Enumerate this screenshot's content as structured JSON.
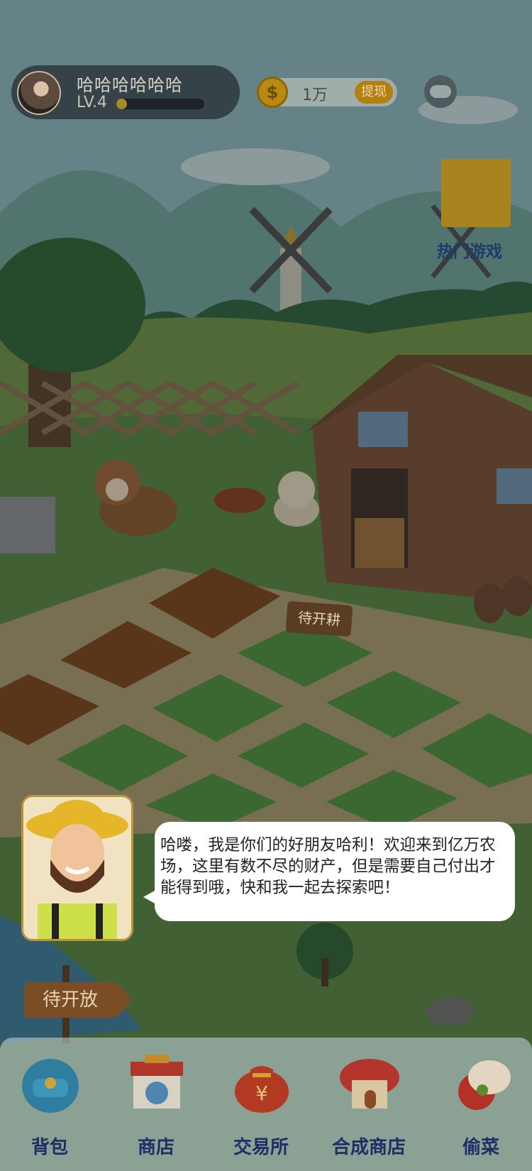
{
  "profile": {
    "name": "哈哈哈哈哈哈",
    "level": "LV.4",
    "level_progress": 0.12
  },
  "currency": {
    "icon": "coin-icon",
    "coin_symbol": "$",
    "amount": "1万",
    "withdraw_label": "提现"
  },
  "weather": {
    "icon": "cloudy-icon"
  },
  "hot_games": {
    "label": "热门游戏"
  },
  "field_sign": {
    "label": "待开耕"
  },
  "road_sign": {
    "label": "待开放"
  },
  "dialog": {
    "text": "哈喽，我是你们的好朋友哈利！欢迎来到亿万农场，这里有数不尽的财产，但是需要自己付出才能得到哦，快和我一起去探索吧！"
  },
  "nav": [
    {
      "label": "背包",
      "icon": "backpack-icon"
    },
    {
      "label": "商店",
      "icon": "shop-icon"
    },
    {
      "label": "交易所",
      "icon": "money-bag-icon",
      "symbol": "¥"
    },
    {
      "label": "合成商店",
      "icon": "house-icon"
    },
    {
      "label": "偷菜",
      "icon": "steal-hand-icon"
    }
  ],
  "colors": {
    "accent": "#b57f10",
    "nav_text": "#1d2f66",
    "overlay": "rgba(20,30,40,0.32)"
  }
}
